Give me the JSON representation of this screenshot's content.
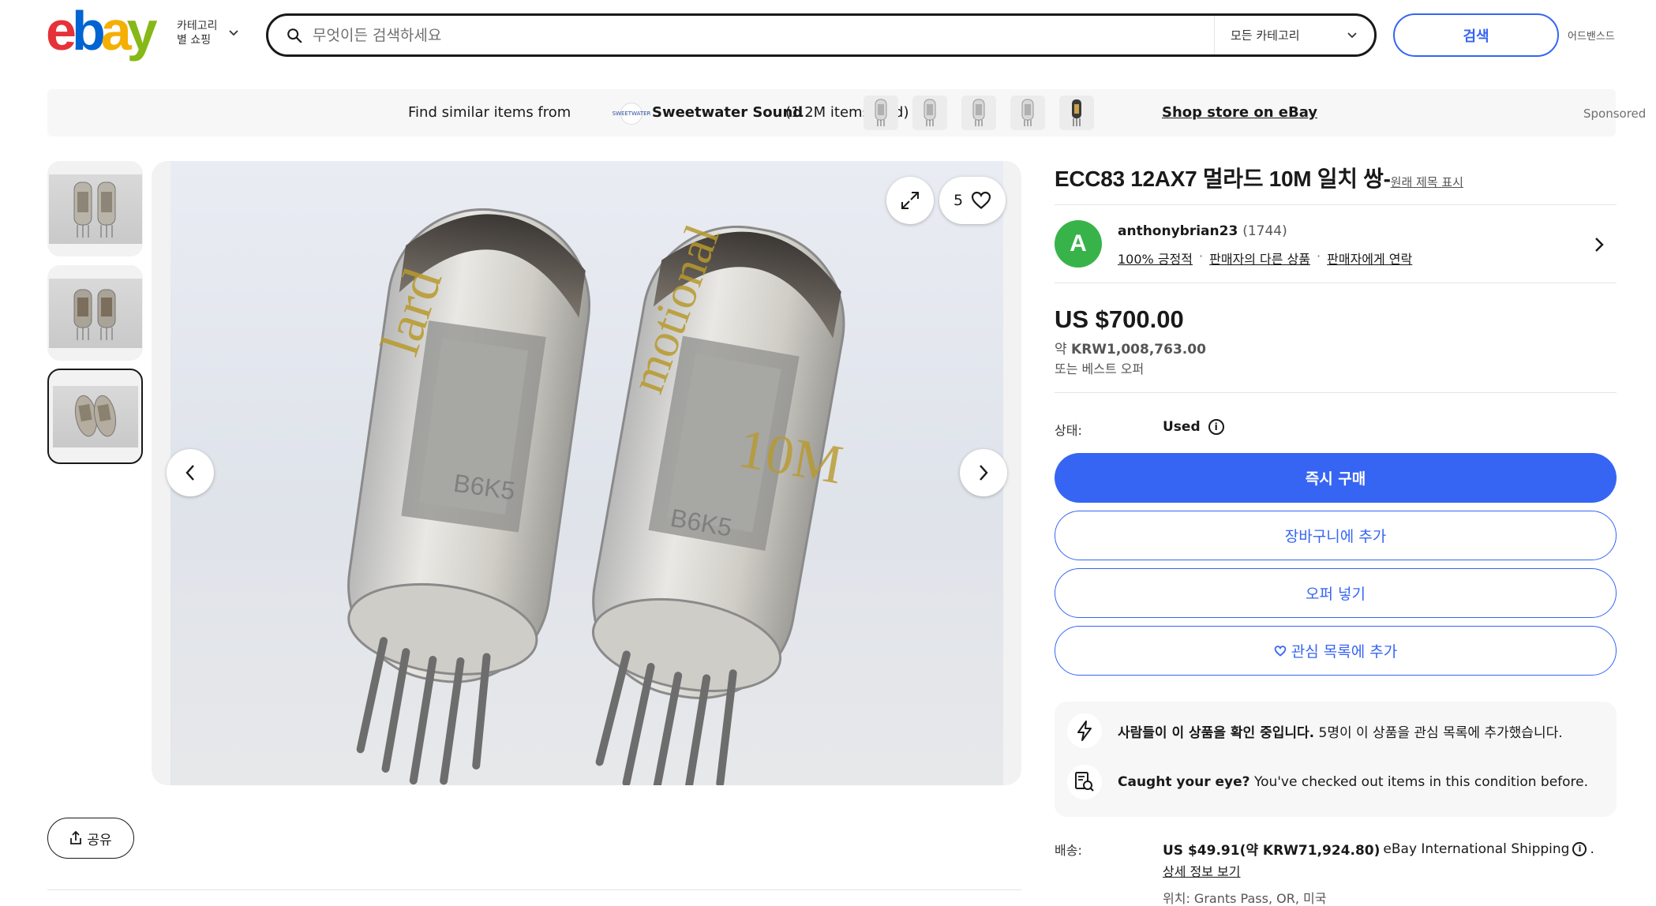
{
  "header": {
    "logo": {
      "letters": [
        "e",
        "b",
        "a",
        "y"
      ],
      "colors": [
        "#e53238",
        "#0064d2",
        "#f5af02",
        "#86b817"
      ]
    },
    "category_menu": {
      "line1": "카테고리",
      "line2": "별 쇼핑"
    },
    "search": {
      "placeholder": "무엇이든 검색하세요",
      "category": "모든 카테고리",
      "button": "검색"
    },
    "advanced": "어드밴스드"
  },
  "banner": {
    "find_text": "Find similar items from",
    "store_avatar": "SWEETWATER",
    "store_name": "Sweetwater Sound",
    "store_sold": "(1.2M items sold)",
    "shop_link": "Shop store on eBay",
    "sponsored": "Sponsored"
  },
  "gallery": {
    "thumbnail_count": 3,
    "active_thumbnail": 3,
    "watch_count": "5",
    "share": "공유"
  },
  "product": {
    "title": "ECC83 12AX7 멀라드 10M 일치 쌍-",
    "original_title_link": "원래 제목 표시",
    "seller": {
      "avatar_letter": "A",
      "name": "anthonybrian23",
      "feedback": "(1744)",
      "positive": "100% 긍정적",
      "other_items": "판매자의 다른 상품",
      "contact": "판매자에게 연락"
    },
    "price": "US $700.00",
    "approx_prefix": "약",
    "approx_value": "KRW1,008,763.00",
    "best_offer": "또는 베스트 오퍼",
    "condition_label": "상태:",
    "condition_value": "Used",
    "buttons": {
      "buy_now": "즉시 구매",
      "add_to_cart": "장바구니에 추가",
      "make_offer": "오퍼 넣기",
      "watchlist": "관심 목록에 추가"
    },
    "signals": {
      "watching_bold": "사람들이 이 상품을 확인 중입니다.",
      "watching_count": "5",
      "watching_rest": "명이 이 상품을 관심 목록에 추가했습니다.",
      "caught_bold": "Caught your eye?",
      "caught_rest": "You've checked out items in this condition before."
    },
    "shipping": {
      "label": "배송:",
      "price": "US $49.91(약 KRW71,924.80)",
      "method": "eBay International Shipping",
      "end": ".",
      "details": "상세 정보 보기",
      "location": "위치: Grants Pass, OR, 미국"
    }
  }
}
